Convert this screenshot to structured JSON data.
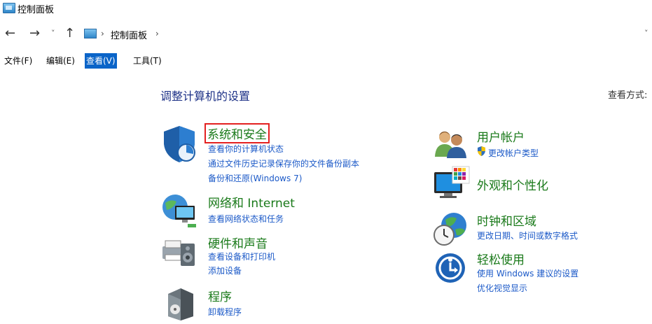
{
  "window": {
    "title": "控制面板"
  },
  "address": {
    "crumb": "控制面板",
    "sep": "›"
  },
  "nav": {
    "back": "←",
    "forward": "→",
    "recent": "˅",
    "up": "↑",
    "dropdown": "˅"
  },
  "menu": [
    {
      "label": "文件(F)"
    },
    {
      "label": "编辑(E)"
    },
    {
      "label": "查看(V)"
    },
    {
      "label": "工具(T)"
    }
  ],
  "main": {
    "heading": "调整计算机的设置",
    "view_by": "查看方式:",
    "left": [
      {
        "title": "系统和安全",
        "icon": "shield-icon",
        "links": [
          "查看你的计算机状态",
          "通过文件历史记录保存你的文件备份副本",
          "备份和还原(Windows 7)"
        ]
      },
      {
        "title": "网络和 Internet",
        "icon": "network-globe-icon",
        "links": [
          "查看网络状态和任务"
        ]
      },
      {
        "title": "硬件和声音",
        "icon": "printer-speaker-icon",
        "links": [
          "查看设备和打印机",
          "添加设备"
        ]
      },
      {
        "title": "程序",
        "icon": "programs-box-icon",
        "links": [
          "卸载程序"
        ]
      }
    ],
    "right": [
      {
        "title": "用户帐户",
        "icon": "users-icon",
        "links": [
          "更改帐户类型"
        ]
      },
      {
        "title": "外观和个性化",
        "icon": "monitor-color-icon",
        "links": []
      },
      {
        "title": "时钟和区域",
        "icon": "clock-globe-icon",
        "links": [
          "更改日期、时间或数字格式"
        ]
      },
      {
        "title": "轻松使用",
        "icon": "ease-of-access-icon",
        "links": [
          "使用 Windows 建议的设置",
          "优化视觉显示"
        ]
      }
    ]
  },
  "colors": {
    "menu_active": "#0a64c8",
    "category_title": "#1a7a1a",
    "link": "#1c5ac8",
    "highlight_border": "#e32020"
  }
}
